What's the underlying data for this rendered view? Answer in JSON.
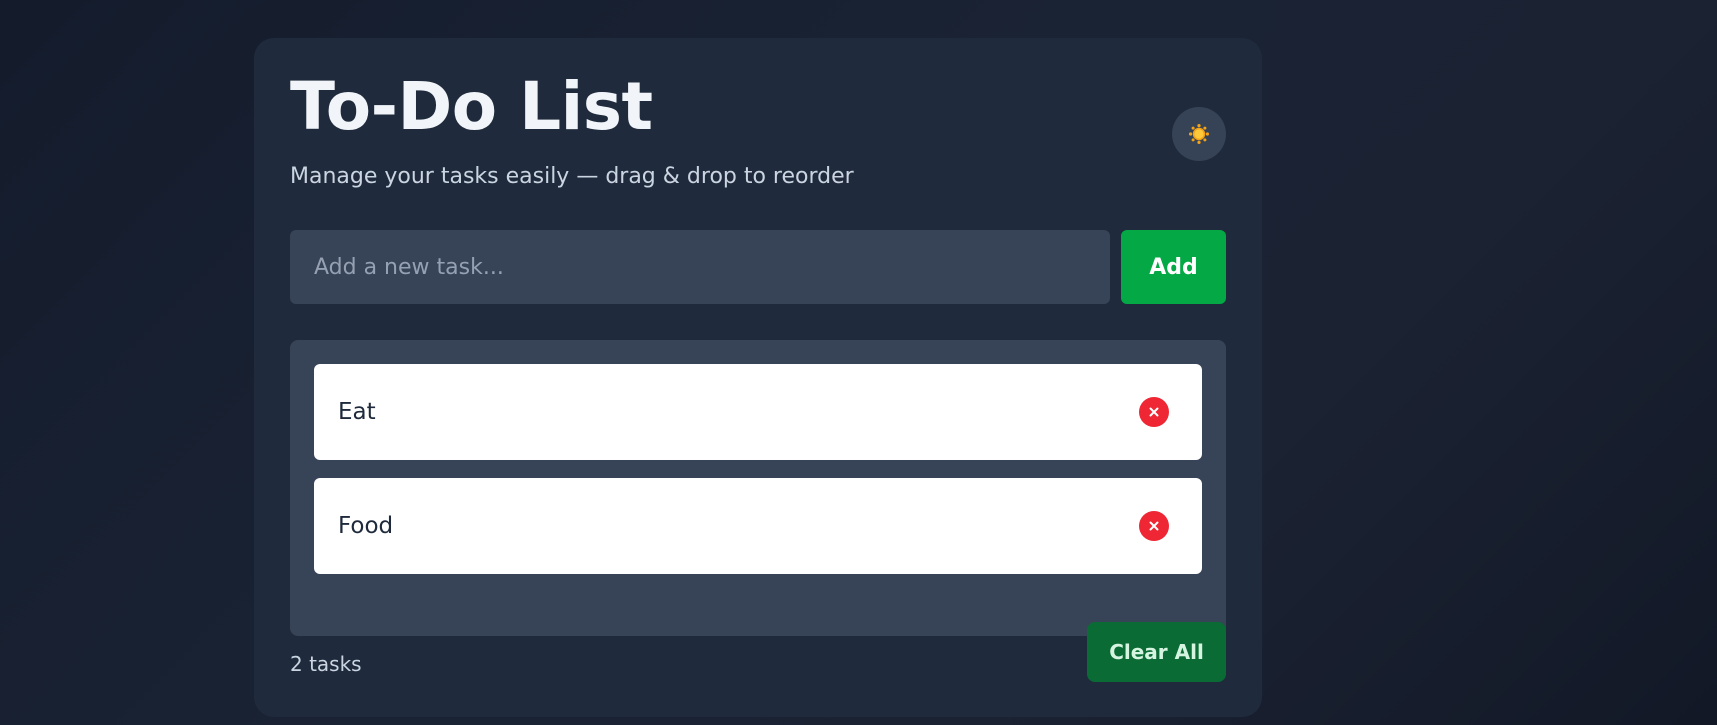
{
  "header": {
    "title": "To-Do List",
    "subtitle": "Manage your tasks easily — drag & drop to reorder",
    "theme_toggle_icon": "sun-icon"
  },
  "input": {
    "value": "",
    "placeholder": "Add a new task..."
  },
  "add_button_label": "Add",
  "tasks": [
    {
      "text": "Eat",
      "delete_icon": "close-icon"
    },
    {
      "text": "Food",
      "delete_icon": "close-icon"
    }
  ],
  "footer": {
    "count_text": "2 tasks",
    "clear_label": "Clear All"
  },
  "colors": {
    "background": "#1a2334",
    "card": "#1f2a3c",
    "input_bg": "#374357",
    "accent_green": "#04a845",
    "clear_green": "#0a6b35",
    "delete_red": "#ef2634",
    "sun": "#f5b417"
  }
}
